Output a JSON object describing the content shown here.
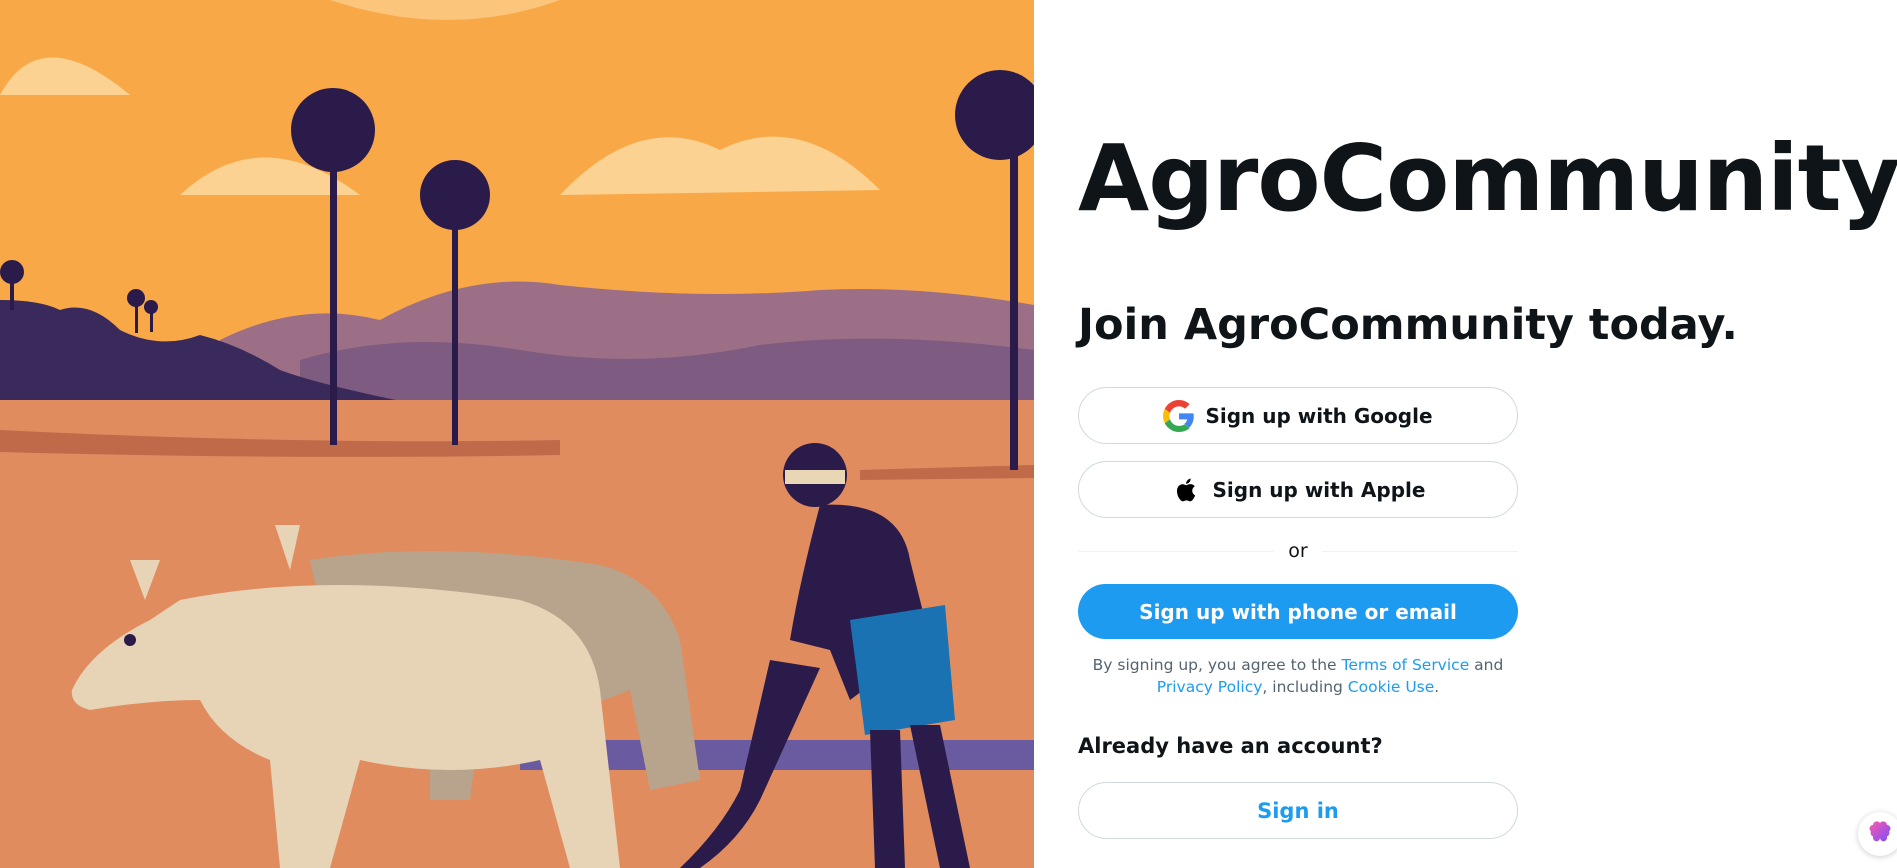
{
  "brand": {
    "name": "AgroCommunity"
  },
  "signup": {
    "heading": "Join AgroCommunity today.",
    "google_label": "Sign up with Google",
    "apple_label": "Sign up with Apple",
    "divider_text": "or",
    "phone_email_label": "Sign up with phone or email",
    "legal": {
      "prefix": "By signing up, you agree to the ",
      "terms": "Terms of Service",
      "and": " and",
      "privacy": "Privacy Policy",
      "including": ", including ",
      "cookie": "Cookie Use",
      "suffix": "."
    }
  },
  "signin": {
    "prompt": "Already have an account?",
    "button_label": "Sign in"
  },
  "icons": {
    "google": "google-logo-icon",
    "apple": "apple-logo-icon",
    "widget": "brain-icon"
  },
  "colors": {
    "accent": "#1d9bf0",
    "text": "#0f1419",
    "muted": "#536471",
    "sky": "#f9a847",
    "ground": "#e08c5f"
  }
}
